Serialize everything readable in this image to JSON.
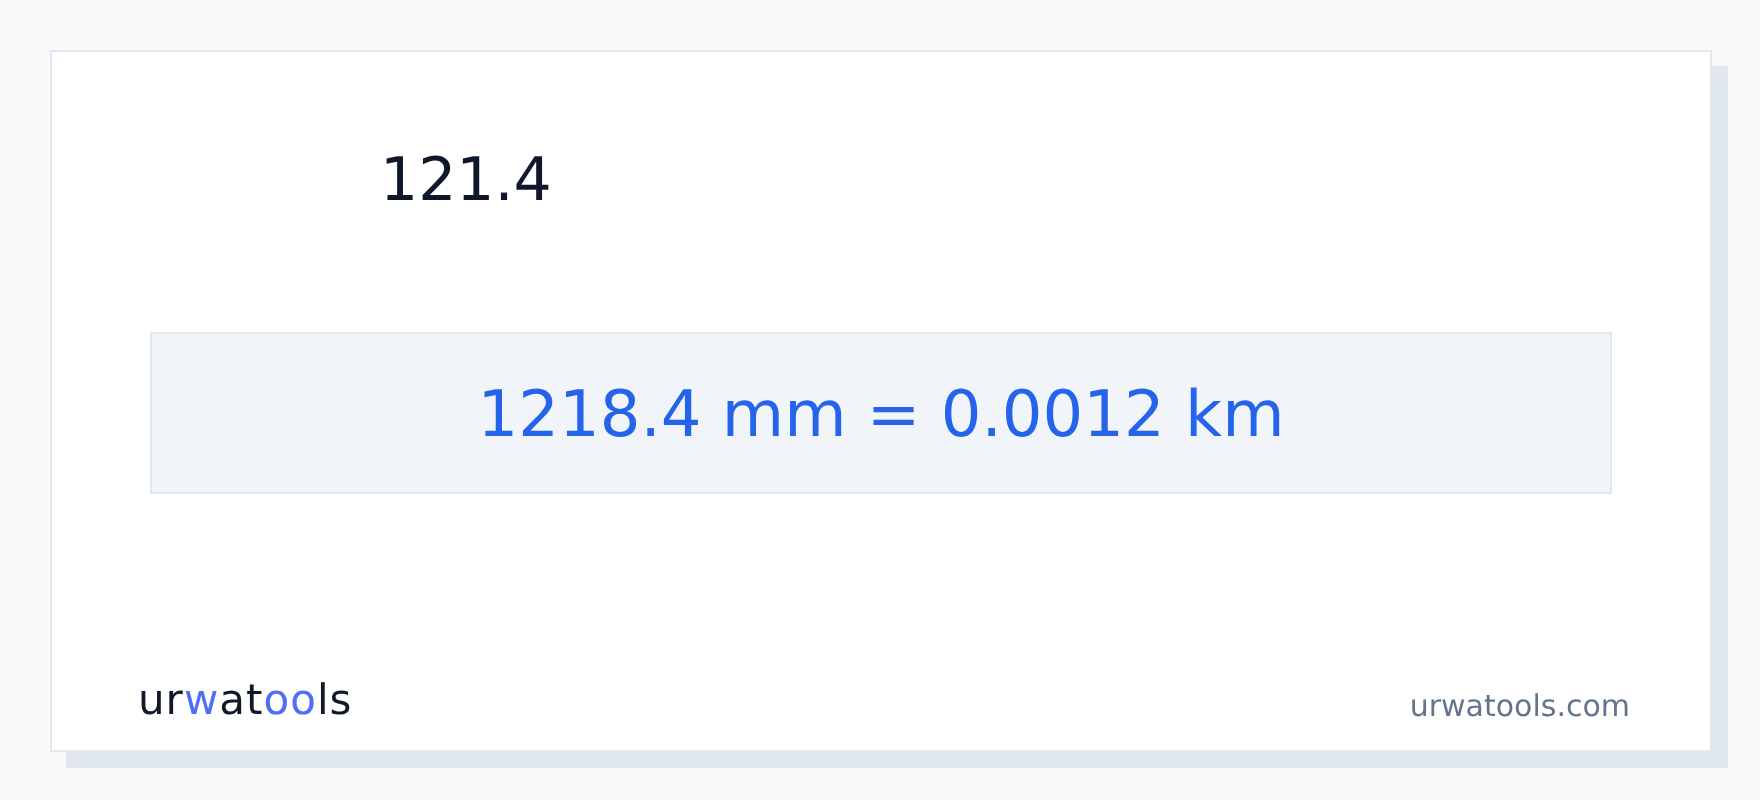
{
  "input": {
    "value": "121.4"
  },
  "result": "1218.4 mm = 0.0012 km",
  "logo": [
    {
      "text": "ur",
      "accent": false
    },
    {
      "text": "w",
      "accent": true
    },
    {
      "text": "at",
      "accent": false
    },
    {
      "text": "oo",
      "accent": true
    },
    {
      "text": "ls",
      "accent": false
    }
  ],
  "site": "urwatools.com"
}
